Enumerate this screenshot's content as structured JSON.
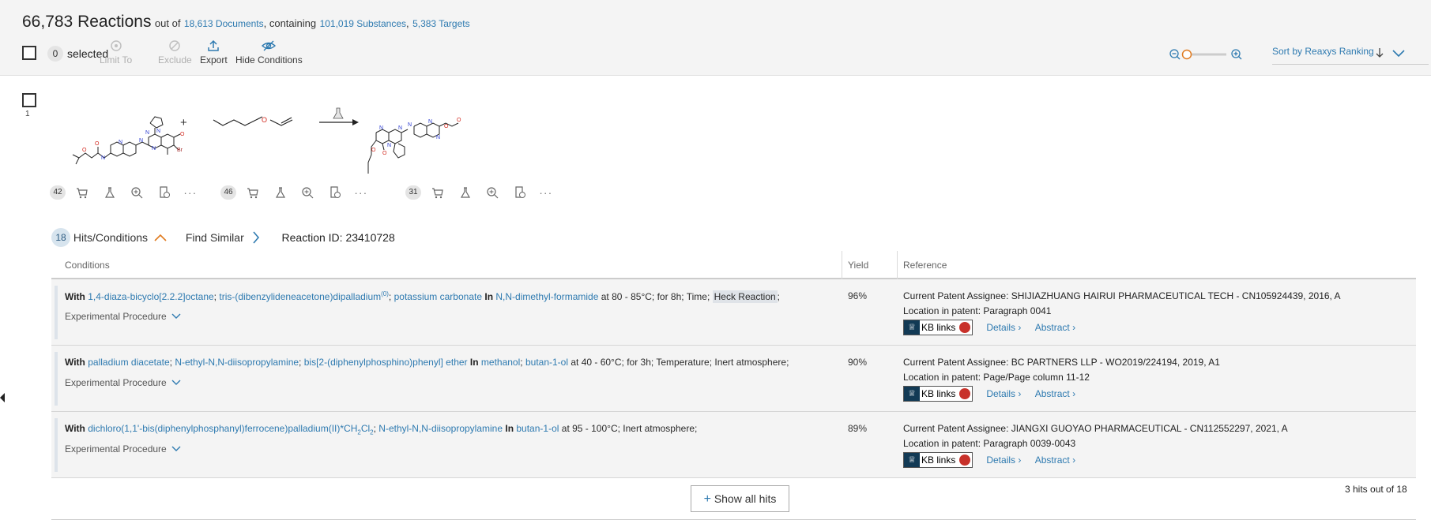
{
  "header": {
    "count": "66,783 Reactions",
    "out_of": "out of",
    "documents": "18,613 Documents",
    "containing": ", containing",
    "substances": "101,019 Substances",
    "targets": "5,383 Targets"
  },
  "toolbar": {
    "selected_count": "0",
    "selected_label": "selected",
    "limit_to": "Limit To",
    "exclude": "Exclude",
    "export": "Export",
    "hide_conditions": "Hide Conditions",
    "sort_label": "Sort by Reaxys Ranking"
  },
  "reaction": {
    "index": "1",
    "molecule_counts": [
      "42",
      "46",
      "31"
    ],
    "plus": "+",
    "hits_count": "18",
    "hits_label": "Hits/Conditions",
    "find_similar": "Find Similar",
    "reaction_id": "Reaction ID: 23410728"
  },
  "table": {
    "col_conditions": "Conditions",
    "col_yield": "Yield",
    "col_reference": "Reference",
    "experimental_procedure": "Experimental Procedure",
    "kb_links": "KB links",
    "details": "Details",
    "abstract": "Abstract",
    "rows": [
      {
        "with": "With",
        "reagent1": "1,4-diaza-bicyclo[2.2.2]octane",
        "sep1": ";",
        "reagent2": "tris-(dibenzylideneacetone)dipalladium",
        "reagent2_sup": "(0)",
        "sep2": ";",
        "reagent3": "potassium carbonate",
        "in": "In",
        "solvent1": "N,N-dimethyl-formamide",
        "conditions": "at 80 - 85°C; for 8h; Time;",
        "highlight": "Heck Reaction",
        "tail": ";",
        "yield": "96%",
        "assignee": "Current Patent Assignee: SHIJIAZHUANG HAIRUI PHARMACEUTICAL TECH - CN105924439, 2016, A",
        "location": "Location in patent: Paragraph 0041"
      },
      {
        "with": "With",
        "reagent1": "palladium diacetate",
        "sep1": ";",
        "reagent2": "N-ethyl-N,N-diisopropylamine",
        "sep2": ";",
        "reagent3": "bis[2-(diphenylphosphino)phenyl] ether",
        "in": "In",
        "solvent1": "methanol",
        "sep3": ";",
        "solvent2": "butan-1-ol",
        "conditions": "at 40 - 60°C; for 3h; Temperature; Inert atmosphere;",
        "yield": "90%",
        "assignee": "Current Patent Assignee: BC PARTNERS LLP - WO2019/224194, 2019, A1",
        "location": "Location in patent: Page/Page column 11-12"
      },
      {
        "with": "With",
        "reagent1_a": "dichloro(1,1'-bis(diphenylphosphanyl)ferrocene)palladium(II)*CH",
        "reagent1_sub1": "2",
        "reagent1_b": "Cl",
        "reagent1_sub2": "2",
        "sep1": ";",
        "reagent2": "N-ethyl-N,N-diisopropylamine",
        "in": "In",
        "solvent1": "butan-1-ol",
        "conditions": "at 95 - 100°C; Inert atmosphere;",
        "yield": "89%",
        "assignee": "Current Patent Assignee: JIANGXI GUOYAO PHARMACEUTICAL - CN112552297, 2021, A",
        "location": "Location in patent: Paragraph 0039-0043"
      }
    ]
  },
  "footer": {
    "show_all": "Show all hits",
    "hits_out_of": "3 hits out of 18"
  },
  "colors": {
    "link": "#2e7ab0",
    "accent_orange": "#e07b20",
    "header_bg": "#f4f4f4"
  },
  "icons": [
    "checkbox-icon",
    "limit-to-icon",
    "exclude-icon",
    "export-icon",
    "hide-conditions-icon",
    "zoom-out-icon",
    "zoom-in-icon",
    "sort-arrow-icon",
    "cart-icon",
    "flask-icon",
    "magnify-icon",
    "document-icon",
    "more-icon",
    "chevron-up-icon",
    "chevron-right-icon",
    "chevron-down-icon",
    "plus-icon",
    "kb-icon"
  ]
}
